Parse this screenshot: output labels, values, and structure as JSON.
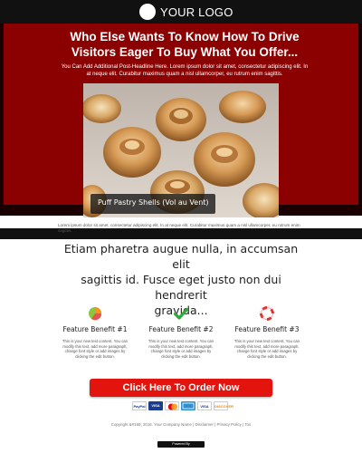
{
  "header": {
    "logo_text": "YOUR LOGO"
  },
  "hero": {
    "headline_line1": "Who Else Wants To Know How To Drive",
    "headline_line2": "Visitors Eager To Buy What You Offer...",
    "subheadline_line1": "You Can Add Additional Post-Headline Here. Lorem ipsum dolor sit amet, consectetur adipiscing elit. In",
    "subheadline_line2": "at neque elit. Curabitur maximus quam a nisl ullamcorper, eu rutrum enim sagittis.",
    "image_caption": "Puff Pastry Shells (Vol au Vent)"
  },
  "intro": {
    "text": "Lorem ipsum dolor sit amet, consectetur adipiscing elit. In at neque elit. Curabitur maximus quam a nisl ullamcorper, eu rutrum enim sagittis."
  },
  "quote": {
    "line1": "Etiam pharetra augue nulla, in accumsan elit",
    "line2": "sagittis id. Fusce eget justo non dui hendrerit",
    "line3": "gravida..."
  },
  "features": [
    {
      "icon": "pie-chart-icon",
      "title": "Feature Benefit #1",
      "body": "This is your new text content. You can modify this text, add more paragraph, change font style or add images by clicking the edit button."
    },
    {
      "icon": "checkmark-icon",
      "title": "Feature Benefit #2",
      "body": "This is your new text content. You can modify this text, add more paragraph, change font style or add images by clicking the edit button."
    },
    {
      "icon": "lifebuoy-icon",
      "title": "Feature Benefit #3",
      "body": "This is your new text content. You can modify this text, add more paragraph, change font style or add images by clicking the edit button."
    }
  ],
  "cta": {
    "label": "Click Here To Order Now"
  },
  "payments": {
    "paypal": "PayPal",
    "visa": "VISA",
    "visa2": "VISA",
    "discover": "DISCOVER"
  },
  "footer": {
    "text": "Copyright &#169; 2016. Your Company Name | Disclaimer | Privacy Policy | Tos",
    "powered": "Powered By"
  },
  "colors": {
    "hero_red": "#8b0000",
    "cta_red": "#e3130e",
    "dark": "#111111"
  }
}
